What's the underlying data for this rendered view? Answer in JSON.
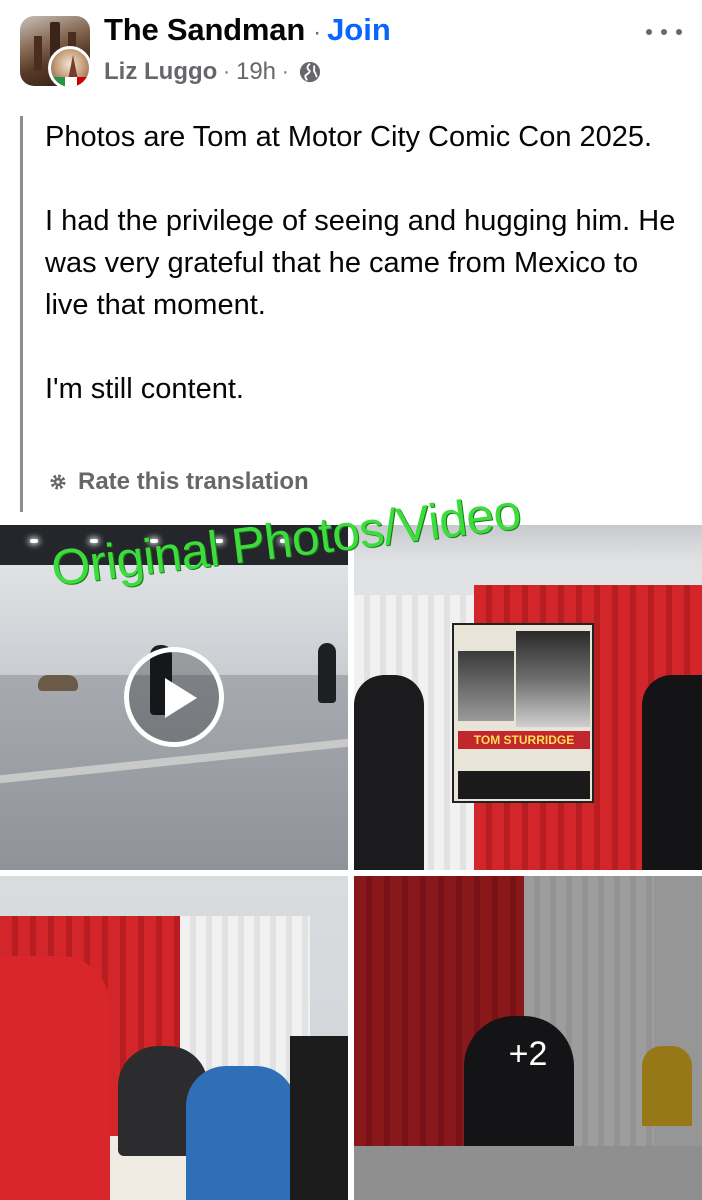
{
  "header": {
    "group_name": "The Sandman",
    "separator": "·",
    "join_label": "Join",
    "author": "Liz Luggo",
    "time": "19h",
    "privacy_icon": "globe-icon",
    "more_icon": "more-options-icon"
  },
  "post": {
    "paragraphs": [
      "Photos are Tom at Motor City Comic Con 2025.",
      "I had the privilege of seeing and hugging him. He was very grateful that he came from Mexico to live that moment.",
      "I'm still content."
    ],
    "rate_translation_label": "Rate this translation"
  },
  "media": {
    "overlay_text": "Original Photos/Video",
    "poster_name": "TOM STURRIDGE",
    "more_count": "+2"
  },
  "colors": {
    "link_blue": "#0866ff",
    "secondary_text": "#65676b",
    "overlay_green": "#3ddc3d"
  }
}
